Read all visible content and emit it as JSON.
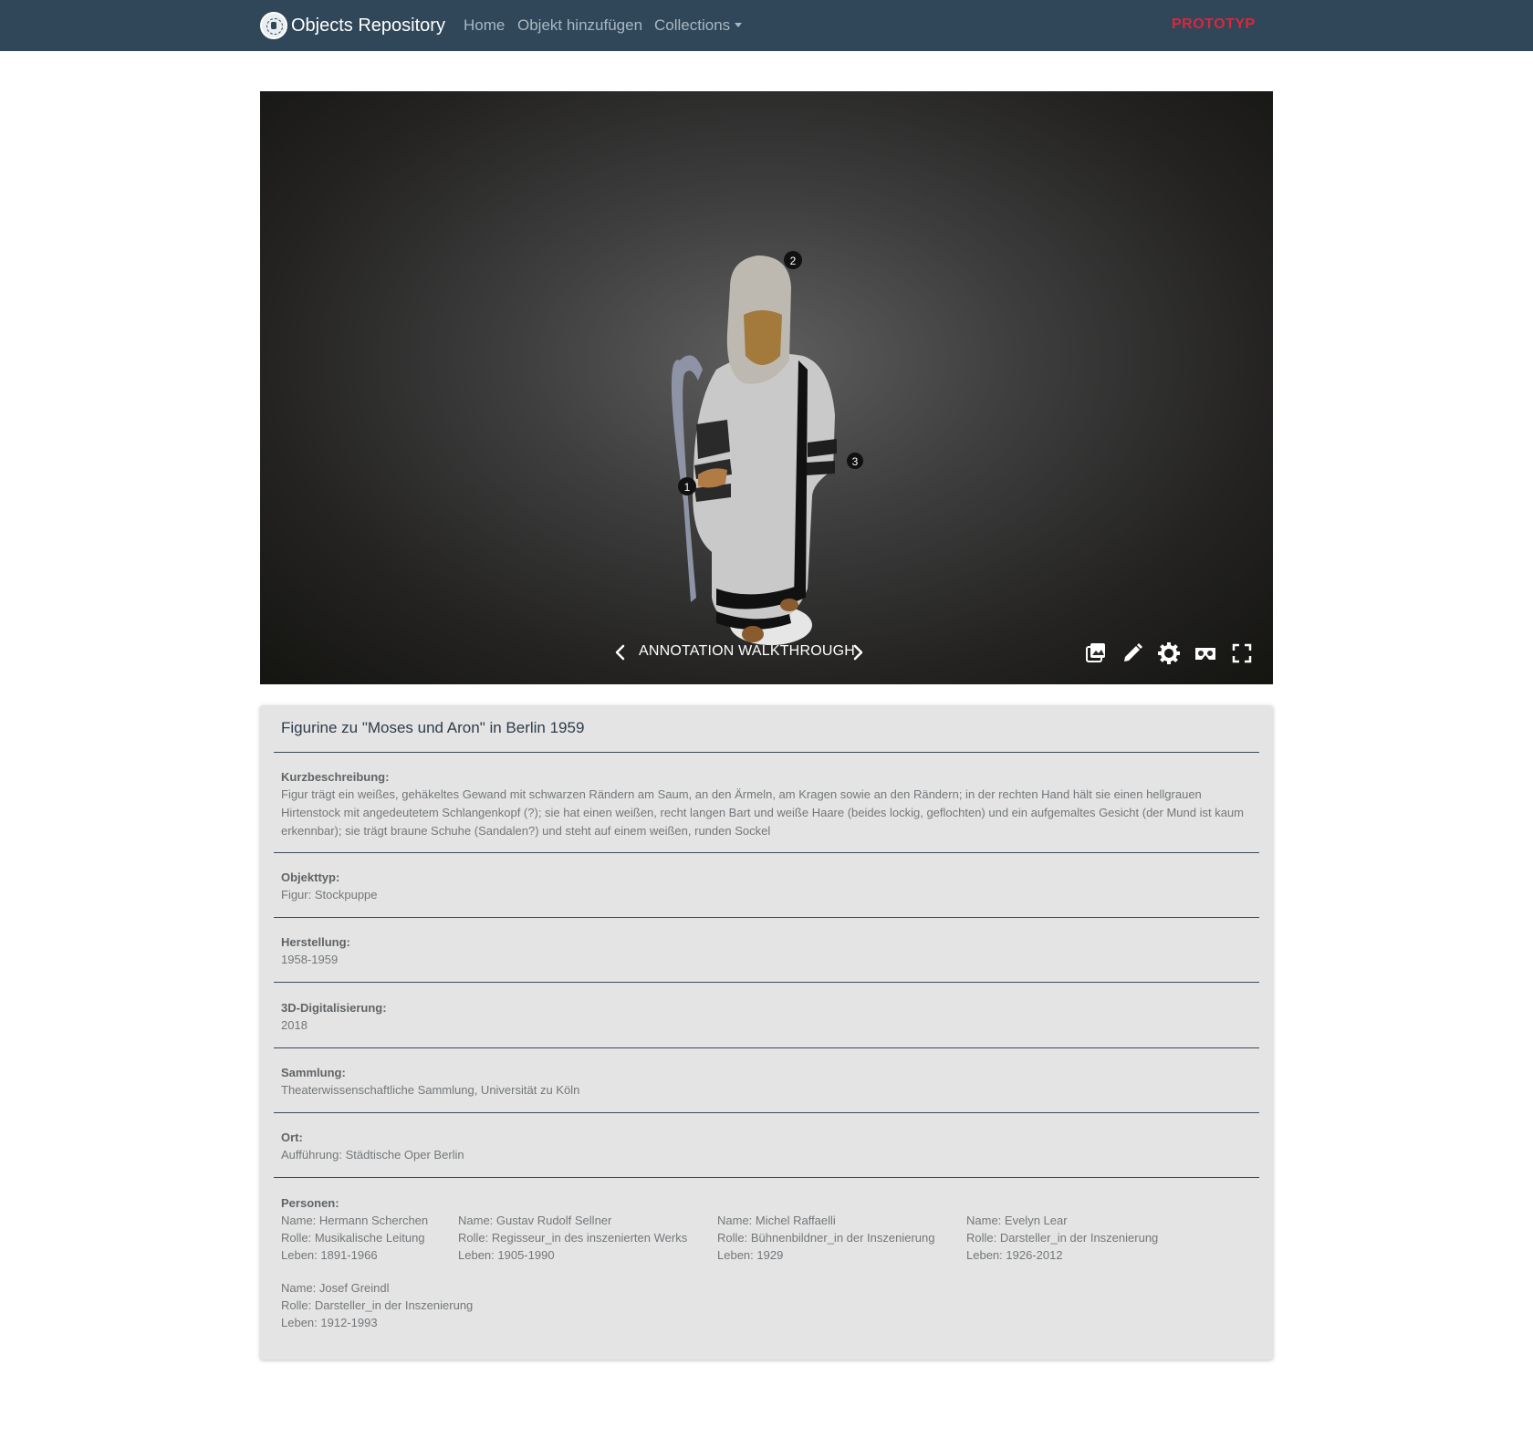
{
  "navbar": {
    "brand": "Objects Repository",
    "links": [
      "Home",
      "Objekt hinzufügen",
      "Collections"
    ],
    "badge": "PROTOTYP"
  },
  "viewer": {
    "walkthrough_label": "ANNOTATION WALKTHROUGH",
    "hotspots": [
      "1",
      "2",
      "3"
    ],
    "tools": [
      "gallery-icon",
      "pencil-icon",
      "gear-icon",
      "vr-goggles-icon",
      "fullscreen-icon"
    ]
  },
  "detail": {
    "title": "Figurine zu \"Moses und Aron\" in Berlin 1959",
    "fields": [
      {
        "label": "Kurzbeschreibung:",
        "value": "Figur trägt ein weißes, gehäkeltes Gewand mit schwarzen Rändern am Saum, an den Ärmeln, am Kragen sowie an den Rändern; in der rechten Hand hält sie einen hellgrauen Hirtenstock mit angedeutetem Schlangenkopf (?); sie hat einen weißen, recht langen Bart und weiße Haare (beides lockig, geflochten) und ein aufgemaltes Gesicht (der Mund ist kaum erkennbar); sie trägt braune Schuhe (Sandalen?) und steht auf einem weißen, runden Sockel"
      },
      {
        "label": "Objekttyp:",
        "value": "Figur: Stockpuppe"
      },
      {
        "label": "Herstellung:",
        "value": "1958-1959"
      },
      {
        "label": "3D-Digitalisierung:",
        "value": "2018"
      },
      {
        "label": "Sammlung:",
        "value": "Theaterwissenschaftliche Sammlung, Universität zu Köln"
      },
      {
        "label": "Ort:",
        "value": "Aufführung: Städtische Oper Berlin"
      }
    ],
    "persons_label": "Personen:",
    "persons": [
      {
        "name": "Name: Hermann Scherchen",
        "role": "Rolle: Musikalische Leitung",
        "life": "Leben: 1891-1966"
      },
      {
        "name": "Name: Gustav Rudolf Sellner",
        "role": "Rolle: Regisseur_in des inszenierten Werks",
        "life": "Leben: 1905-1990"
      },
      {
        "name": "Name: Michel Raffaelli",
        "role": "Rolle: Bühnenbildner_in der Inszenierung",
        "life": "Leben: 1929"
      },
      {
        "name": "Name: Evelyn Lear",
        "role": "Rolle: Darsteller_in der Inszenierung",
        "life": "Leben: 1926-2012"
      },
      {
        "name": "Name: Josef Greindl",
        "role": "Rolle: Darsteller_in der Inszenierung",
        "life": "Leben: 1912-1993"
      }
    ]
  },
  "colors": {
    "navbar_bg": "#2f4759",
    "badge": "#e0243c",
    "card_bg": "#e4e4e4"
  }
}
